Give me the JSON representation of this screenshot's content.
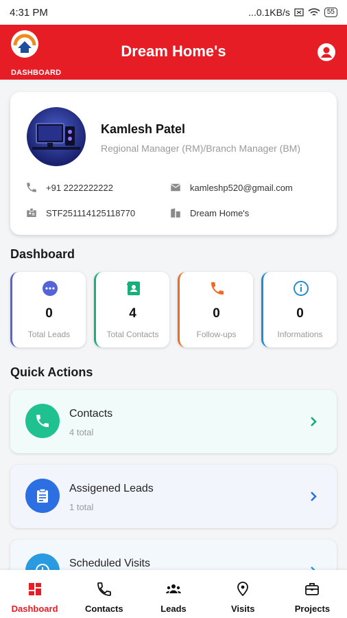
{
  "status_bar": {
    "time": "4:31 PM",
    "network": "...0.1KB/s",
    "battery": "55"
  },
  "header": {
    "logo_label": "DASHBOARD",
    "title": "Dream Home's"
  },
  "profile": {
    "name": "Kamlesh Patel",
    "role": "Regional Manager (RM)/Branch Manager (BM)",
    "phone": "+91 2222222222",
    "email": "kamleshp520@gmail.com",
    "staff_id": "STF251114125118770",
    "company": "Dream Home's"
  },
  "dashboard": {
    "title": "Dashboard",
    "stats": [
      {
        "value": "0",
        "label": "Total Leads",
        "color": "#5463d6"
      },
      {
        "value": "4",
        "label": "Total Contacts",
        "color": "#17b07a"
      },
      {
        "value": "0",
        "label": "Follow-ups",
        "color": "#f2691b"
      },
      {
        "value": "0",
        "label": "Informations",
        "color": "#1e8ed0"
      }
    ]
  },
  "quick_actions": {
    "title": "Quick Actions",
    "items": [
      {
        "title": "Contacts",
        "sub": "4 total",
        "bg": "#f1fbf9",
        "circle": "#1fc190",
        "chev": "#17a880"
      },
      {
        "title": "Assigened Leads",
        "sub": "1 total",
        "bg": "#f3f5fd",
        "circle": "#2b6fe3",
        "chev": "#2b6fe3"
      },
      {
        "title": "Scheduled Visits",
        "sub": "",
        "bg": "#f3f8fd",
        "circle": "#2a9be0",
        "chev": "#2a9be0"
      }
    ]
  },
  "nav": [
    {
      "label": "Dashboard",
      "icon": "dashboard-icon",
      "active": true
    },
    {
      "label": "Contacts",
      "icon": "phone-icon"
    },
    {
      "label": "Leads",
      "icon": "group-icon"
    },
    {
      "label": "Visits",
      "icon": "location-icon"
    },
    {
      "label": "Projects",
      "icon": "briefcase-icon"
    }
  ],
  "colors": {
    "brand": "#e61d25"
  }
}
